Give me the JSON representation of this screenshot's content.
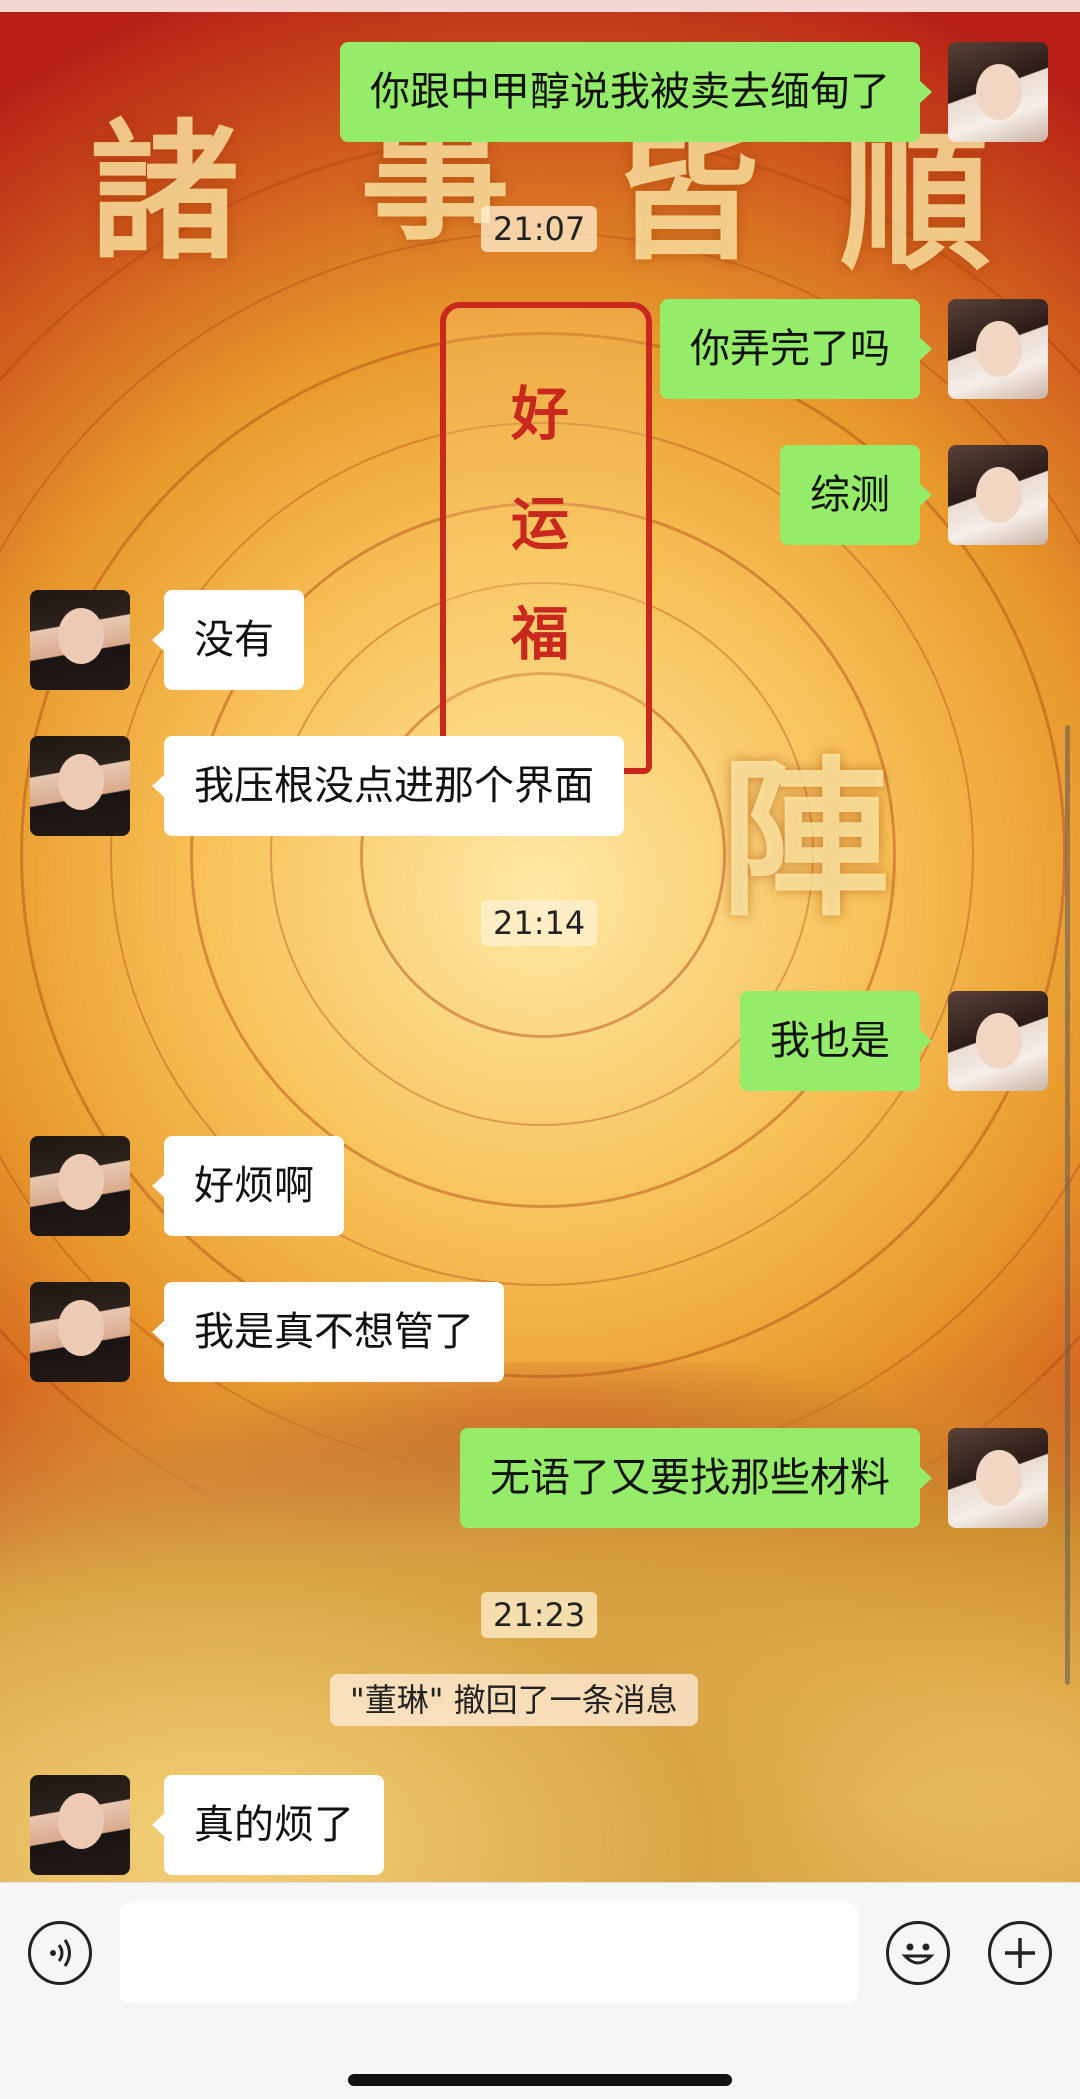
{
  "messages": [
    {
      "side": "me",
      "text": "你跟中甲醇说我被卖去缅甸了"
    },
    {
      "type": "time",
      "text": "21:07"
    },
    {
      "side": "me",
      "text": "你弄完了吗"
    },
    {
      "side": "me",
      "text": "综测"
    },
    {
      "side": "other",
      "text": "没有"
    },
    {
      "side": "other",
      "text": "我压根没点进那个界面"
    },
    {
      "type": "time",
      "text": "21:14"
    },
    {
      "side": "me",
      "text": "我也是"
    },
    {
      "side": "other",
      "text": "好烦啊"
    },
    {
      "side": "other",
      "text": "我是真不想管了"
    },
    {
      "side": "me",
      "text": "无语了又要找那些材料"
    },
    {
      "type": "time",
      "text": "21:23"
    },
    {
      "type": "recall",
      "text": "\"董琳\" 撤回了一条消息"
    },
    {
      "side": "other",
      "text": "真的烦了"
    }
  ],
  "wallpaper": {
    "top_chars": [
      "諸",
      "事",
      "皆",
      "順"
    ],
    "pendant_chars": [
      "好",
      "运",
      "福"
    ],
    "center_char": "陣"
  },
  "input_bar": {
    "voice_icon": "voice-icon",
    "emoji_icon": "emoji-icon",
    "plus_icon": "plus-icon"
  },
  "colors": {
    "my_bubble": "#95ec69",
    "other_bubble": "#ffffff",
    "input_bar_bg": "#f6f6f6"
  }
}
